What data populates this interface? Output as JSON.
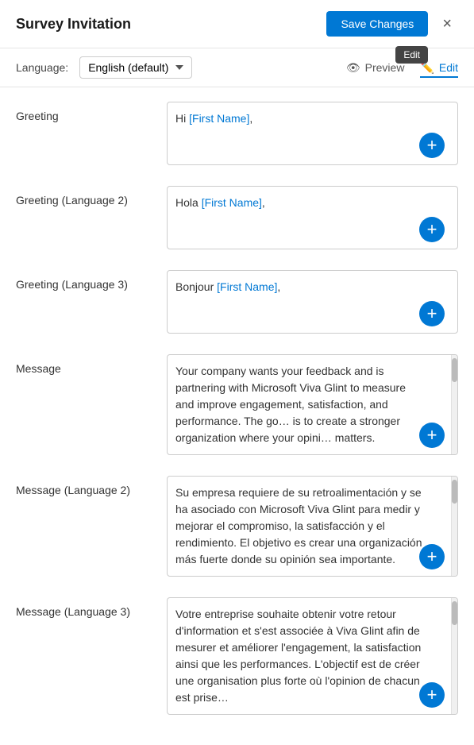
{
  "header": {
    "title": "Survey Invitation",
    "save_label": "Save Changes",
    "close_label": "×",
    "tooltip": "Edit"
  },
  "toolbar": {
    "language_label": "Language:",
    "language_value": "English (default)",
    "preview_label": "Preview",
    "edit_label": "Edit"
  },
  "fields": [
    {
      "id": "greeting",
      "label": "Greeting",
      "text_before": "Hi ",
      "highlight": "[First Name]",
      "text_after": ",",
      "has_scrollbar": false,
      "tall": false
    },
    {
      "id": "greeting-lang2",
      "label": "Greeting (Language 2)",
      "text_before": "Hola ",
      "highlight": "[First Name]",
      "text_after": ",",
      "has_scrollbar": false,
      "tall": false
    },
    {
      "id": "greeting-lang3",
      "label": "Greeting (Language 3)",
      "text_before": "Bonjour ",
      "highlight": "[First Name]",
      "text_after": ",",
      "has_scrollbar": false,
      "tall": false
    },
    {
      "id": "message",
      "label": "Message",
      "text_before": "Your company wants your feedback and is partnering with Microsoft Viva Glint to measure and improve engagement, satisfaction, and performance. The go… is to create a stronger organization where your opini… matters.",
      "highlight": "",
      "text_after": "",
      "has_scrollbar": true,
      "tall": true
    },
    {
      "id": "message-lang2",
      "label": "Message (Language 2)",
      "text_before": "Su empresa requiere de su retroalimentación y se ha asociado con Microsoft Viva Glint para medir y mejorar el compromiso, la satisfacción y el rendimiento. El objetivo es crear una organización más fuerte donde su opinión sea importante.",
      "highlight": "",
      "text_after": "",
      "has_scrollbar": true,
      "tall": true
    },
    {
      "id": "message-lang3",
      "label": "Message (Language 3)",
      "text_before": "Votre entreprise souhaite obtenir votre retour d'information et s'est associée à Viva Glint afin de mesurer et améliorer l'engagement, la satisfaction ainsi que les performances. L'objectif est de créer une organisation plus forte où l'opinion de chacun est prise…",
      "highlight": "",
      "text_after": "",
      "has_scrollbar": true,
      "tall": true
    }
  ]
}
